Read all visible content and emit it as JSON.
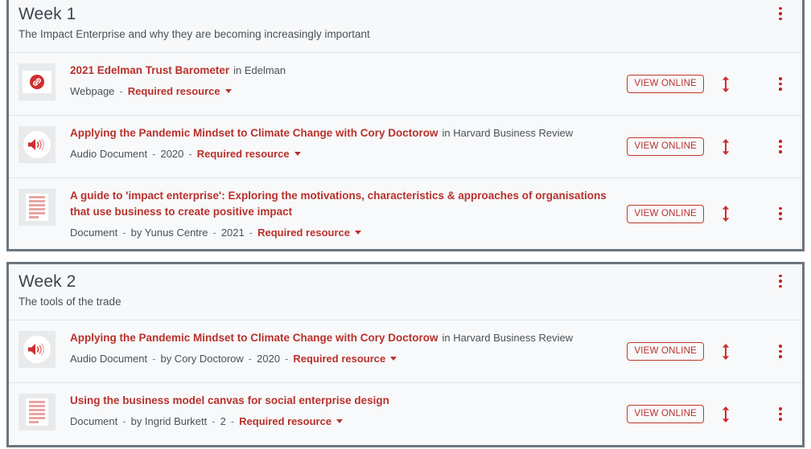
{
  "colors": {
    "accent_red": "#b8312c",
    "border_gray": "#6c757d",
    "text_gray": "#4a5158",
    "row_bg": "#f8f9fa"
  },
  "sections": [
    {
      "title": "Week 1",
      "subtitle": "The Impact Enterprise and why they are becoming increasingly important",
      "items": [
        {
          "icon": "link-icon",
          "title": "2021 Edelman Trust Barometer",
          "source": "in Edelman",
          "type": "Webpage",
          "author": "",
          "year": "",
          "requirement": "Required resource",
          "action_label": "VIEW ONLINE"
        },
        {
          "icon": "audio-icon",
          "title": "Applying the Pandemic Mindset to Climate Change with Cory Doctorow",
          "source": "in Harvard Business Review",
          "type": "Audio Document",
          "author": "",
          "year": "2020",
          "requirement": "Required resource",
          "action_label": "VIEW ONLINE"
        },
        {
          "icon": "document-icon",
          "title": "A guide to 'impact enterprise': Exploring the motivations, characteristics & approaches of organisations that use business to create positive impact",
          "source": "",
          "type": "Document",
          "author": "by Yunus Centre",
          "year": "2021",
          "requirement": "Required resource",
          "action_label": "VIEW ONLINE"
        }
      ]
    },
    {
      "title": "Week 2",
      "subtitle": "The tools of the trade",
      "items": [
        {
          "icon": "audio-icon",
          "title": "Applying the Pandemic Mindset to Climate Change with Cory Doctorow",
          "source": "in Harvard Business Review",
          "type": "Audio Document",
          "author": "by Cory Doctorow",
          "year": "2020",
          "requirement": "Required resource",
          "action_label": "VIEW ONLINE"
        },
        {
          "icon": "document-icon",
          "title": "Using the business model canvas for social enterprise design",
          "source": "",
          "type": "Document",
          "author": "by Ingrid Burkett",
          "year": "2",
          "requirement": "Required resource",
          "action_label": "VIEW ONLINE"
        }
      ]
    }
  ]
}
